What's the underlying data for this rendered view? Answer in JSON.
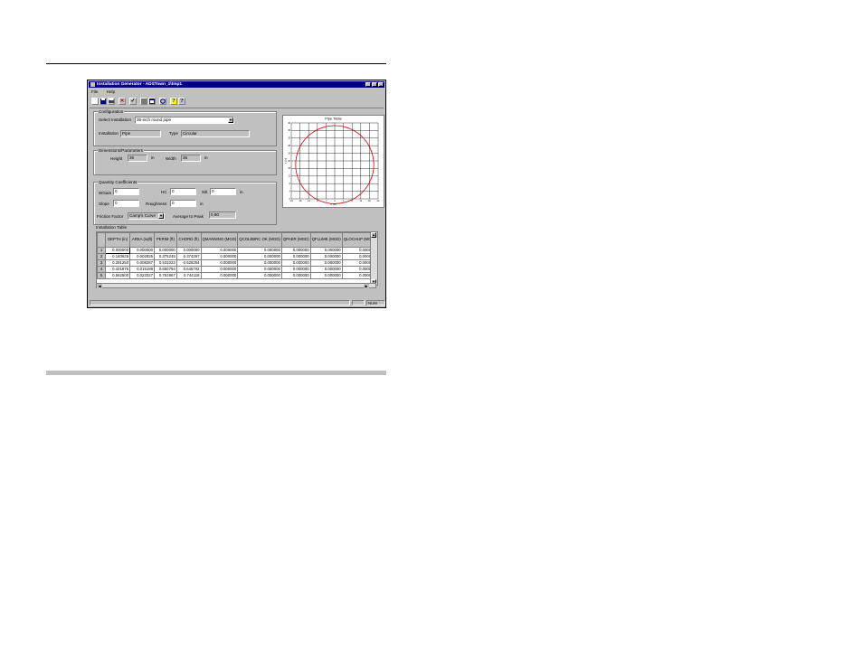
{
  "window": {
    "title": "Installation Generator - ADSTown_1\\tmp1"
  },
  "titlebar_buttons": [
    "_",
    "□",
    "×"
  ],
  "menu": [
    "File",
    "Help"
  ],
  "toolbar": {
    "icons": [
      "new-icon",
      "save-icon",
      "print-icon",
      "delete-icon",
      "check-icon",
      "list-icon",
      "window-icon",
      "pipe-icon",
      "help-icon",
      "context-help-icon"
    ]
  },
  "configuration": {
    "group_label": "Configuration",
    "select_label": "Select Installation",
    "select_value": "36-inch round pipe",
    "installation_label": "Installation",
    "installation_value": "Pipe",
    "type_label": "Type",
    "type_value": "Circular"
  },
  "dimensions": {
    "group_label": "Dimensions/Parameters",
    "height_label": "Height",
    "height_value": "36",
    "height_unit": "in",
    "width_label": "Width",
    "width_value": "36",
    "width_unit": "in"
  },
  "coefficients": {
    "group_label": "Quantity Coefficients",
    "wgain_label": "WGain",
    "wgain_value": "0",
    "hc_label": "HC",
    "hc_value": "0",
    "silt_label": "Silt",
    "silt_value": "0",
    "silt_unit": "in",
    "slope_label": "Slope",
    "slope_value": "0",
    "roughness_label": "Roughness",
    "roughness_value": "0",
    "roughness_unit": "in",
    "friction_label": "Friction Factor",
    "friction_value": "Camp's Curve",
    "avg_label": "Average to Peak",
    "avg_value": "0.90"
  },
  "chart_data": {
    "type": "scatter",
    "title": "Pipe Table",
    "xlabel": "X (in)",
    "ylabel": "Y (in)",
    "xlim": [
      -20,
      20
    ],
    "ylim": [
      0,
      40
    ],
    "grid": true,
    "series": [
      {
        "center": [
          0,
          18
        ],
        "radius": 18,
        "color": "#cc0000"
      }
    ]
  },
  "table": {
    "label": "Installation Table",
    "headers": [
      "DEPTH (in)",
      "AREA (sqft)",
      "PERIM (ft)",
      "CHORD (ft)",
      "QMANNING (MGD)",
      "QCOLEBRC OK (MGD)",
      "QPAER (MGD)",
      "QFLUME (MGD)",
      "QLOCHUP (MGD)"
    ],
    "rows": [
      [
        "1",
        "0.000000",
        "0.000000",
        "0.000000",
        "0.000000",
        "0.000000",
        "0.000000",
        "0.000000",
        "0.000000",
        "0.000000"
      ],
      [
        "2",
        "0.140625",
        "0.002926",
        "0.375245",
        "0.374267",
        "0.000000",
        "0.000000",
        "0.000000",
        "0.000000",
        "0.000000"
      ],
      [
        "3",
        "0.281250",
        "0.008287",
        "0.531023",
        "0.528254",
        "0.000000",
        "0.000000",
        "0.000000",
        "0.000000",
        "0.000000"
      ],
      [
        "4",
        "0.421875",
        "0.015189",
        "0.650794",
        "0.645702",
        "0.000000",
        "0.000000",
        "0.000000",
        "0.000000",
        "0.000000"
      ],
      [
        "5",
        "0.562500",
        "0.023327",
        "0.751967",
        "0.744118",
        "0.000000",
        "0.000000",
        "0.000000",
        "0.000000",
        "0.000000"
      ]
    ]
  },
  "status": {
    "text": "NUM"
  },
  "colors": {
    "titlebar": "#000080",
    "face": "#c0c0c0",
    "circle": "#cc0000"
  }
}
